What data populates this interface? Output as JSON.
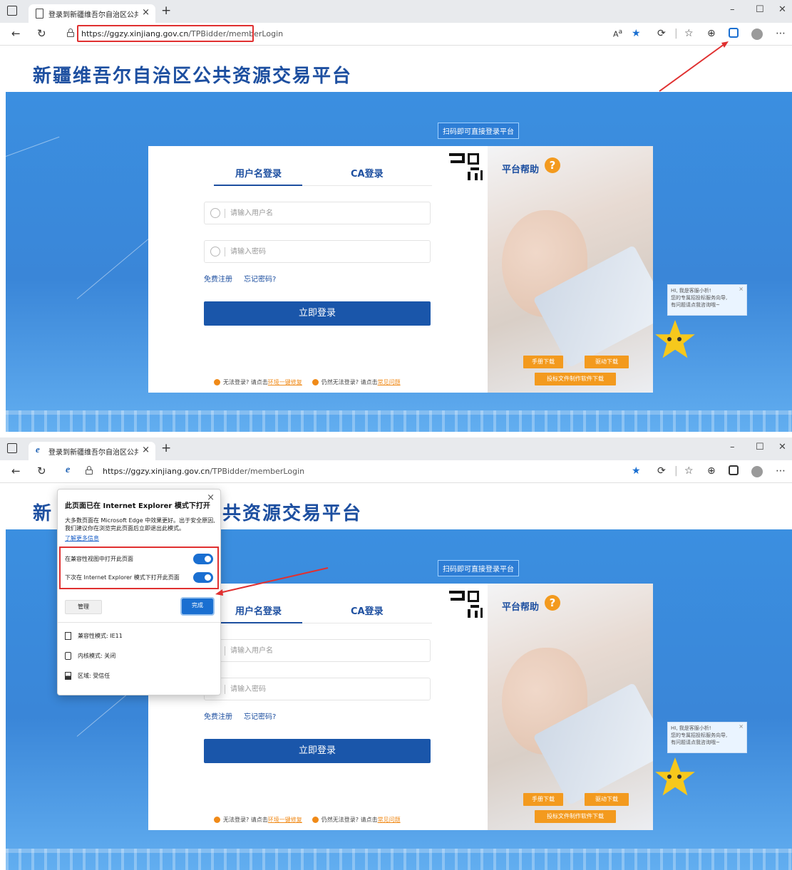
{
  "browser": {
    "tab_title_1": "登录到新疆维吾尔自治区公共资源",
    "tab_title_2": "登录到新疆维吾尔自治区公共资源",
    "url_host": "https://ggzy.xinjiang.gov.cn",
    "url_path": "/TPBidder/memberLogin",
    "new_tab": "+",
    "minimize": "–",
    "maximize": "☐",
    "close": "✕"
  },
  "page": {
    "site_title": "新疆维吾尔自治区公共资源交易平台",
    "site_title_tail": "共资源交易平台",
    "site_title_head": "新",
    "qr_tip": "扫码即可直接登录平台",
    "tab_username": "用户名登录",
    "tab_ca": "CA登录",
    "username_placeholder": "请输入用户名",
    "password_placeholder": "请输入密码",
    "register_link": "免费注册",
    "forgot_link": "忘记密码?",
    "login_button": "立即登录",
    "help_1_prefix": "无法登录? 请点击",
    "help_1_link": "环境一键修复",
    "help_2_prefix": "仍然无法登录? 请点击",
    "help_2_link": "常见问题",
    "platform_help": "平台帮助",
    "help_q": "?",
    "manual_download": "手册下载",
    "driver_download": "驱动下载",
    "tool_download": "投标文件制作软件下载",
    "bubble_title": "HI, 我是客服小析!",
    "bubble_line1": "您的专属招投标服务向导,",
    "bubble_line2": "有问题请点我咨询哦~",
    "bubble_close": "×"
  },
  "ie_popup": {
    "title": "此页面已在 Internet Explorer 模式下打开",
    "description": "大多数页面在 Microsoft Edge 中效果更好。出于安全原因, 我们建议你在浏览完此页面后立即退出此模式。",
    "learn_more": "了解更多信息",
    "toggle_1": "在兼容性视图中打开此页面",
    "toggle_2": "下次在 Internet Explorer 模式下打开此页面",
    "manage": "管理",
    "done": "完成",
    "compat_mode": "兼容性模式: IE11",
    "kernel_mode": "内核模式: 关闭",
    "zone": "区域: 受信任",
    "close": "×"
  },
  "colors": {
    "brand_blue": "#1d4fa0",
    "button_blue": "#1a56aa",
    "accent_orange": "#f39a1e",
    "annotation_red": "#e03030"
  }
}
